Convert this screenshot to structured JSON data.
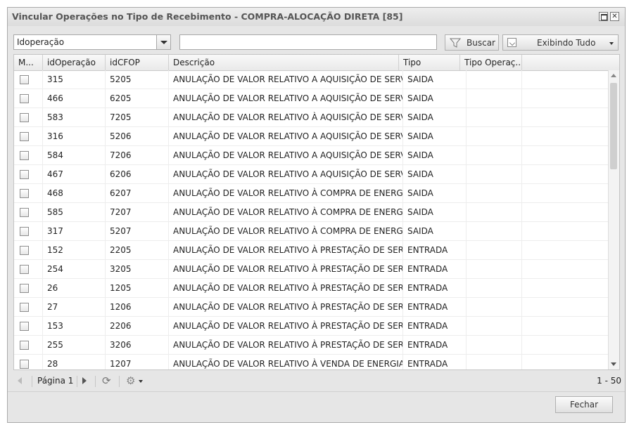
{
  "window": {
    "title": "Vincular Operações no Tipo de Recebimento - COMPRA-ALOCAÇÃO DIRETA [85]"
  },
  "toolbar": {
    "field_combo_value": "Idoperação",
    "search_value": "",
    "search_button_label": "Buscar",
    "display_button_label": "Exibindo Tudo"
  },
  "grid": {
    "columns": [
      "M...",
      "idOperação",
      "idCFOP",
      "Descrição",
      "Tipo",
      "Tipo Operaç..."
    ],
    "rows": [
      {
        "id": "315",
        "cfop": "5205",
        "desc": "ANULAÇÃO DE VALOR RELATIVO A AQUISIÇÃO DE SERVI...",
        "tipo": "SAIDA",
        "tipo_op": ""
      },
      {
        "id": "466",
        "cfop": "6205",
        "desc": "ANULAÇÃO DE VALOR RELATIVO A AQUISIÇÃO DE SERVI...",
        "tipo": "SAIDA",
        "tipo_op": ""
      },
      {
        "id": "583",
        "cfop": "7205",
        "desc": "ANULAÇÃO DE VALOR RELATIVO À AQUISIÇÃO DE SERVI...",
        "tipo": "SAIDA",
        "tipo_op": ""
      },
      {
        "id": "316",
        "cfop": "5206",
        "desc": "ANULAÇÃO DE VALOR RELATIVO A AQUISIÇÃO DE SERVI...",
        "tipo": "SAIDA",
        "tipo_op": ""
      },
      {
        "id": "584",
        "cfop": "7206",
        "desc": "ANULAÇÃO DE VALOR RELATIVO A AQUISIÇÃO DE SERVI...",
        "tipo": "SAIDA",
        "tipo_op": ""
      },
      {
        "id": "467",
        "cfop": "6206",
        "desc": "ANULAÇÃO DE VALOR RELATIVO A AQUISIÇÃO DE SERVI...",
        "tipo": "SAIDA",
        "tipo_op": ""
      },
      {
        "id": "468",
        "cfop": "6207",
        "desc": "ANULAÇÃO DE VALOR RELATIVO À COMPRA DE ENERGIA...",
        "tipo": "SAIDA",
        "tipo_op": ""
      },
      {
        "id": "585",
        "cfop": "7207",
        "desc": "ANULAÇÃO DE VALOR RELATIVO À COMPRA DE ENERGIA...",
        "tipo": "SAIDA",
        "tipo_op": ""
      },
      {
        "id": "317",
        "cfop": "5207",
        "desc": "ANULAÇÃO DE VALOR RELATIVO À COMPRA DE ENERGIA...",
        "tipo": "SAIDA",
        "tipo_op": ""
      },
      {
        "id": "152",
        "cfop": "2205",
        "desc": "ANULAÇÃO DE VALOR RELATIVO À PRESTAÇÃO DE SERV...",
        "tipo": "ENTRADA",
        "tipo_op": ""
      },
      {
        "id": "254",
        "cfop": "3205",
        "desc": "ANULAÇÃO DE VALOR RELATIVO À PRESTAÇÃO DE SERV...",
        "tipo": "ENTRADA",
        "tipo_op": ""
      },
      {
        "id": "26",
        "cfop": "1205",
        "desc": "ANULAÇÃO DE VALOR RELATIVO À PRESTAÇÃO DE SERV...",
        "tipo": "ENTRADA",
        "tipo_op": ""
      },
      {
        "id": "27",
        "cfop": "1206",
        "desc": "ANULAÇÃO DE VALOR RELATIVO À PRESTAÇÃO DE SERV...",
        "tipo": "ENTRADA",
        "tipo_op": ""
      },
      {
        "id": "153",
        "cfop": "2206",
        "desc": "ANULAÇÃO DE VALOR RELATIVO À PRESTAÇÃO DE SERV...",
        "tipo": "ENTRADA",
        "tipo_op": ""
      },
      {
        "id": "255",
        "cfop": "3206",
        "desc": "ANULAÇÃO DE VALOR RELATIVO À PRESTAÇÃO DE SERV...",
        "tipo": "ENTRADA",
        "tipo_op": ""
      },
      {
        "id": "28",
        "cfop": "1207",
        "desc": "ANULAÇÃO DE VALOR RELATIVO À VENDA DE ENERGIA ...",
        "tipo": "ENTRADA",
        "tipo_op": ""
      }
    ]
  },
  "pager": {
    "page_label": "Página 1",
    "range_label": "1 - 50"
  },
  "footer": {
    "close_label": "Fechar"
  }
}
